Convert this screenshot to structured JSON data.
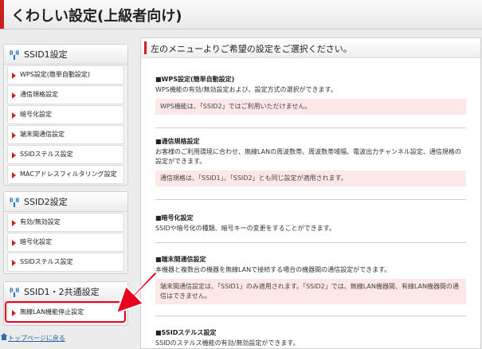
{
  "header": {
    "title": "くわしい設定(上級者向け)"
  },
  "sidebar": {
    "ssid1": {
      "heading": "SSID1設定",
      "items": [
        {
          "label": "WPS設定(簡単自動設定)"
        },
        {
          "label": "通信規格設定"
        },
        {
          "label": "暗号化設定"
        },
        {
          "label": "端末間通信設定"
        },
        {
          "label": "SSIDステルス設定"
        },
        {
          "label": "MACアドレスフィルタリング設定"
        }
      ]
    },
    "ssid2": {
      "heading": "SSID2設定",
      "items": [
        {
          "label": "有効/無効設定"
        },
        {
          "label": "暗号化設定"
        },
        {
          "label": "SSIDステルス設定"
        }
      ]
    },
    "common": {
      "heading": "SSID1・2共通設定",
      "items": [
        {
          "label": "無線LAN機能停止設定"
        }
      ]
    },
    "back_link": "トップページに戻る"
  },
  "main": {
    "heading": "左のメニューよりご希望の設定をご選択ください。",
    "sections": [
      {
        "title": "■WPS設定(簡単自動設定)",
        "desc": "WPS機能の有効/無効設定および、設定方式の選択ができます。",
        "note": "WPS機能は、「SSID2」ではご利用いただけません。"
      },
      {
        "title": "■通信規格設定",
        "desc": "お客様のご利用環境に合わせ、無線LANの周波数帯、周波数帯域幅、電波出力チャンネル設定、通信規格の設定ができます。",
        "note": "通信規格は、「SSID1」、「SSID2」とも同じ設定が適用されます。"
      },
      {
        "title": "■暗号化設定",
        "desc": "SSIDや暗号化の種類、暗号キーの変更をすることができます。",
        "note": ""
      },
      {
        "title": "■端末間通信設定",
        "desc": "本機器と複数台の機器を無線LANで接続する場合の機器間の通信設定ができます。",
        "note": "端末間通信設定は、「SSID1」のみ適用されます。「SSID2」では、無線LAN機器間、有線LAN機器間の通信はできません。"
      },
      {
        "title": "■SSIDステルス設定",
        "desc": "SSIDのステルス機能の有効/無効設定ができます。",
        "note": ""
      }
    ]
  },
  "colors": {
    "accent": "#cc1f1f",
    "highlight": "#e8001c",
    "note_bg": "#fde8e8",
    "link": "#2460a8"
  }
}
